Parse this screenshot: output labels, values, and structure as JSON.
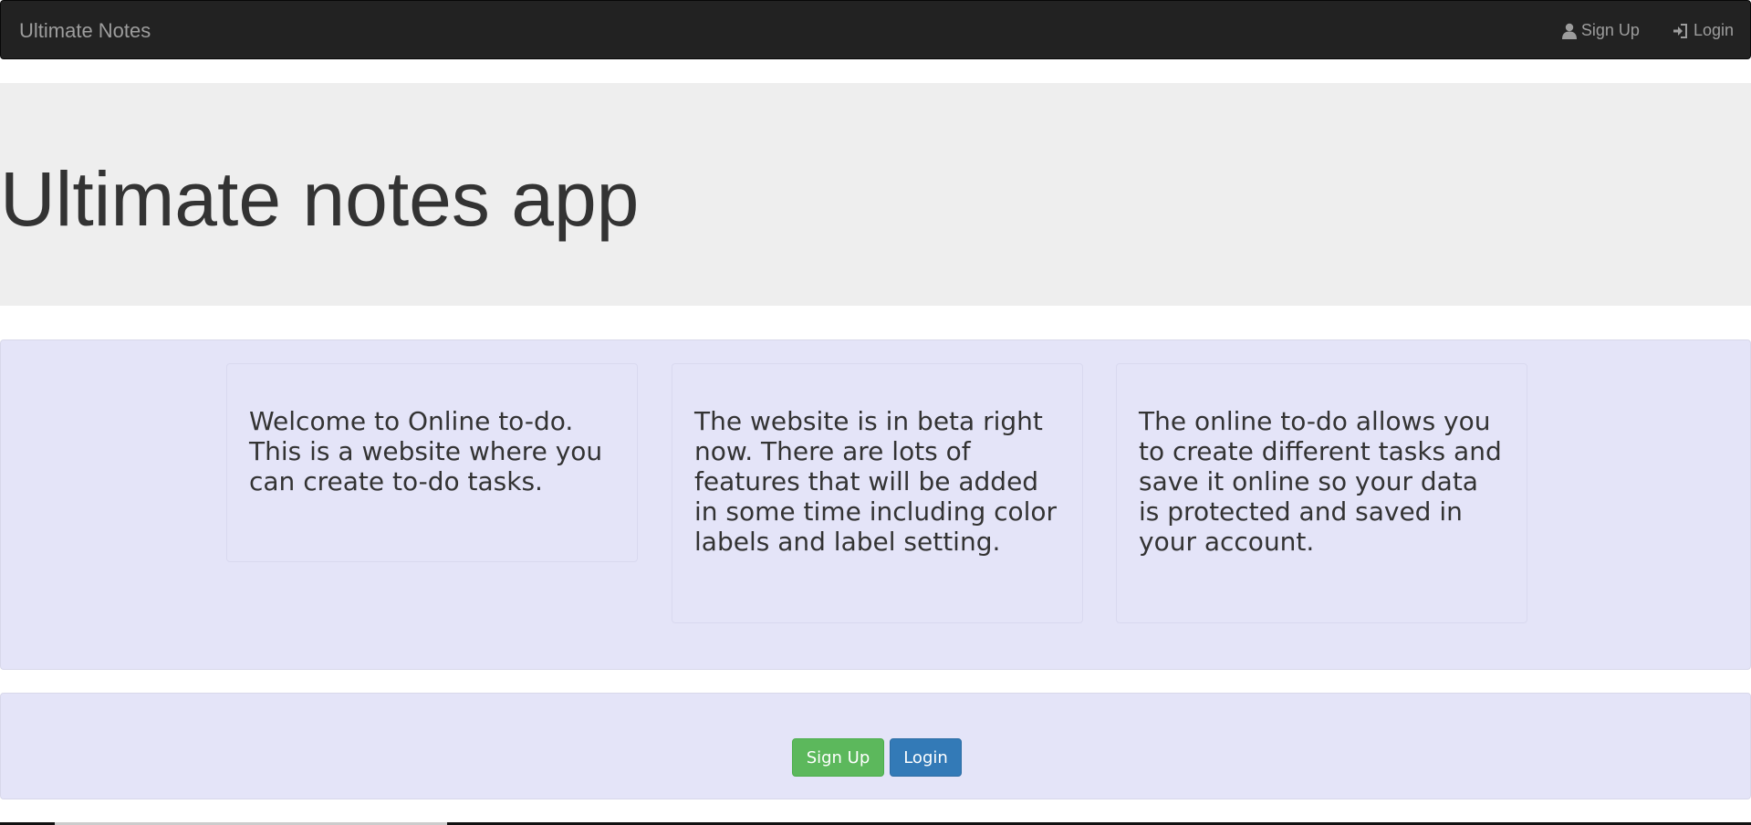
{
  "navbar": {
    "brand": "Ultimate Notes",
    "signup_label": "Sign Up",
    "login_label": "Login"
  },
  "jumbotron": {
    "title": "Ultimate notes app"
  },
  "features": {
    "card1": "Welcome to Online to-do. This is a website where you can create to-do tasks.",
    "card2": "The website is in beta right now. There are lots of features that will be added in some time including color labels and label setting.",
    "card3": "The online to-do allows you to create different tasks and save it online so your data is protected and saved in your account."
  },
  "actions": {
    "signup_label": "Sign Up",
    "login_label": "Login"
  },
  "colors": {
    "navbar_bg": "#222222",
    "jumbotron_bg": "#eeeeee",
    "panel_bg": "#e4e4f8",
    "success": "#5cb85c",
    "primary": "#337ab7"
  },
  "icons": {
    "signup": "user-icon",
    "login": "log-in-icon"
  }
}
